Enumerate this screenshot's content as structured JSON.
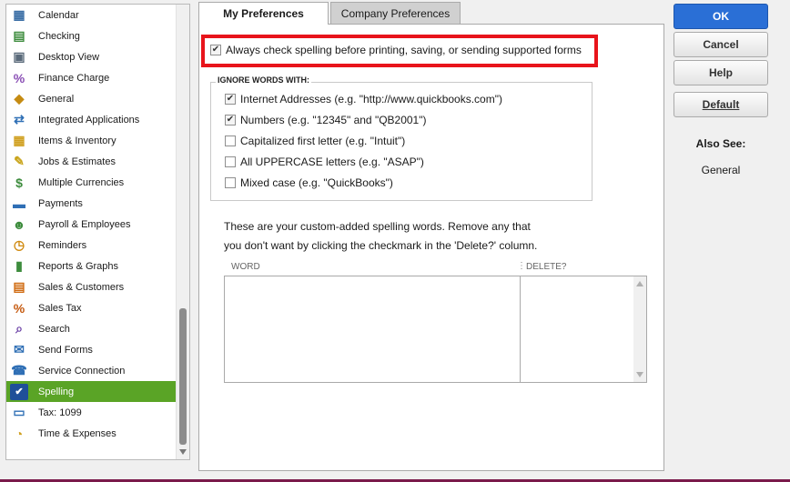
{
  "sidebar": {
    "items": [
      {
        "label": "Calendar",
        "icon": "calendar-icon"
      },
      {
        "label": "Checking",
        "icon": "checking-icon"
      },
      {
        "label": "Desktop View",
        "icon": "desktop-view-icon"
      },
      {
        "label": "Finance Charge",
        "icon": "finance-charge-icon"
      },
      {
        "label": "General",
        "icon": "general-icon"
      },
      {
        "label": "Integrated Applications",
        "icon": "integrated-apps-icon"
      },
      {
        "label": "Items & Inventory",
        "icon": "items-inventory-icon"
      },
      {
        "label": "Jobs & Estimates",
        "icon": "jobs-estimates-icon"
      },
      {
        "label": "Multiple Currencies",
        "icon": "currencies-icon"
      },
      {
        "label": "Payments",
        "icon": "payments-icon"
      },
      {
        "label": "Payroll & Employees",
        "icon": "payroll-icon"
      },
      {
        "label": "Reminders",
        "icon": "reminders-icon"
      },
      {
        "label": "Reports & Graphs",
        "icon": "reports-graphs-icon"
      },
      {
        "label": "Sales & Customers",
        "icon": "sales-customers-icon"
      },
      {
        "label": "Sales Tax",
        "icon": "sales-tax-icon"
      },
      {
        "label": "Search",
        "icon": "search-icon"
      },
      {
        "label": "Send Forms",
        "icon": "send-forms-icon"
      },
      {
        "label": "Service Connection",
        "icon": "service-connection-icon"
      },
      {
        "label": "Spelling",
        "icon": "spelling-icon",
        "selected": true
      },
      {
        "label": "Tax: 1099",
        "icon": "tax-1099-icon"
      },
      {
        "label": "Time & Expenses",
        "icon": "time-expenses-icon"
      }
    ]
  },
  "tabs": {
    "my_prefs": "My Preferences",
    "company_prefs": "Company Preferences",
    "active": "My Preferences"
  },
  "spelling": {
    "always_check": {
      "label": "Always check spelling before printing, saving, or sending supported forms",
      "checked": true
    },
    "ignore_group_label": "IGNORE WORDS WITH:",
    "ignore_options": [
      {
        "label": "Internet Addresses (e.g. \"http://www.quickbooks.com\")",
        "checked": true
      },
      {
        "label": "Numbers (e.g. \"12345\" and \"QB2001\")",
        "checked": true
      },
      {
        "label": "Capitalized first letter (e.g. \"Intuit\")",
        "checked": false
      },
      {
        "label": "All UPPERCASE letters (e.g. \"ASAP\")",
        "checked": false
      },
      {
        "label": "Mixed case (e.g. \"QuickBooks\")",
        "checked": false
      }
    ],
    "custom_desc_line1": "These are your custom-added spelling words.  Remove any that",
    "custom_desc_line2": "you don't want by clicking the checkmark in the 'Delete?' column.",
    "columns": {
      "word": "WORD",
      "delete": "DELETE?"
    },
    "rows": []
  },
  "buttons": {
    "ok": "OK",
    "cancel": "Cancel",
    "help": "Help",
    "default": "Default"
  },
  "also_see": {
    "title": "Also See:",
    "items": [
      "General"
    ]
  },
  "colors": {
    "selected_bg": "#5aa426",
    "highlight_border": "#e8141b",
    "ok_button": "#2a6fd6"
  }
}
